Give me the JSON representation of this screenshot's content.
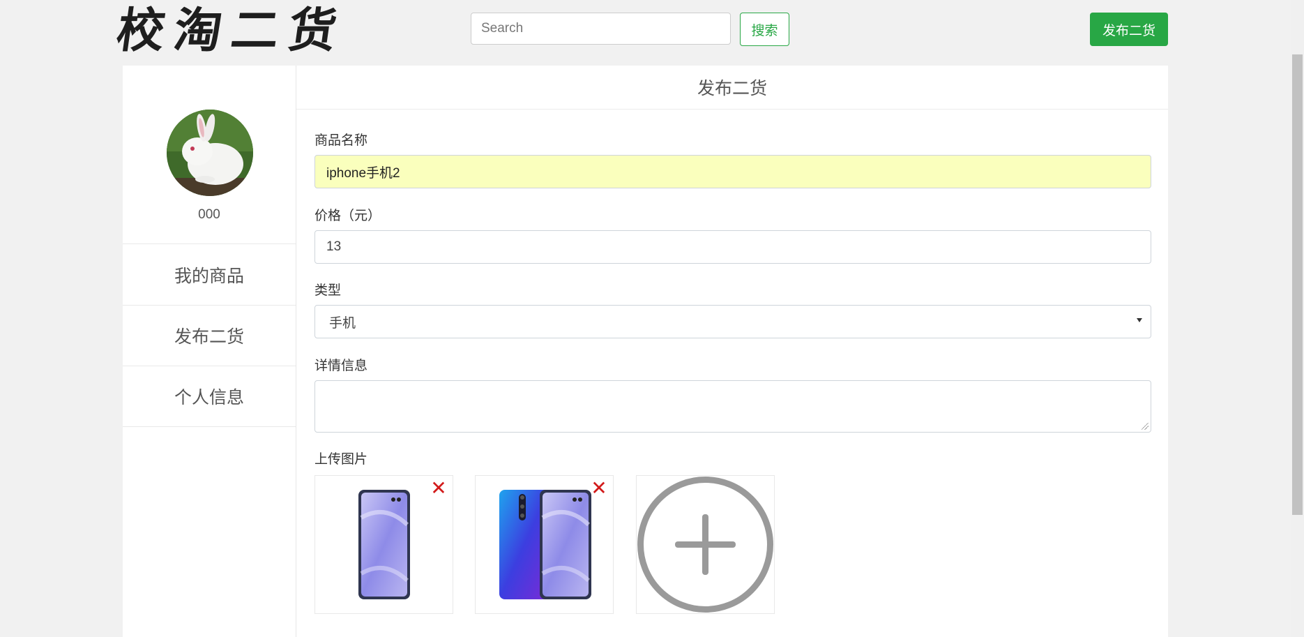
{
  "header": {
    "logo_text": "校淘二货",
    "search_placeholder": "Search",
    "search_button": "搜索",
    "publish_button": "发布二货"
  },
  "sidebar": {
    "username": "000",
    "items": [
      {
        "label": "我的商品"
      },
      {
        "label": "发布二货"
      },
      {
        "label": "个人信息"
      }
    ]
  },
  "form": {
    "title": "发布二货",
    "name_label": "商品名称",
    "name_value": "iphone手机2",
    "price_label": "价格（元）",
    "price_value": "13",
    "type_label": "类型",
    "type_value": "手机",
    "details_label": "详情信息",
    "details_value": "",
    "upload_label": "上传图片"
  },
  "colors": {
    "accent": "#28a745",
    "autofill": "#faffbd",
    "remove": "#d21a1a"
  },
  "icons": {
    "remove": "close-icon",
    "add": "plus-circle-icon"
  }
}
